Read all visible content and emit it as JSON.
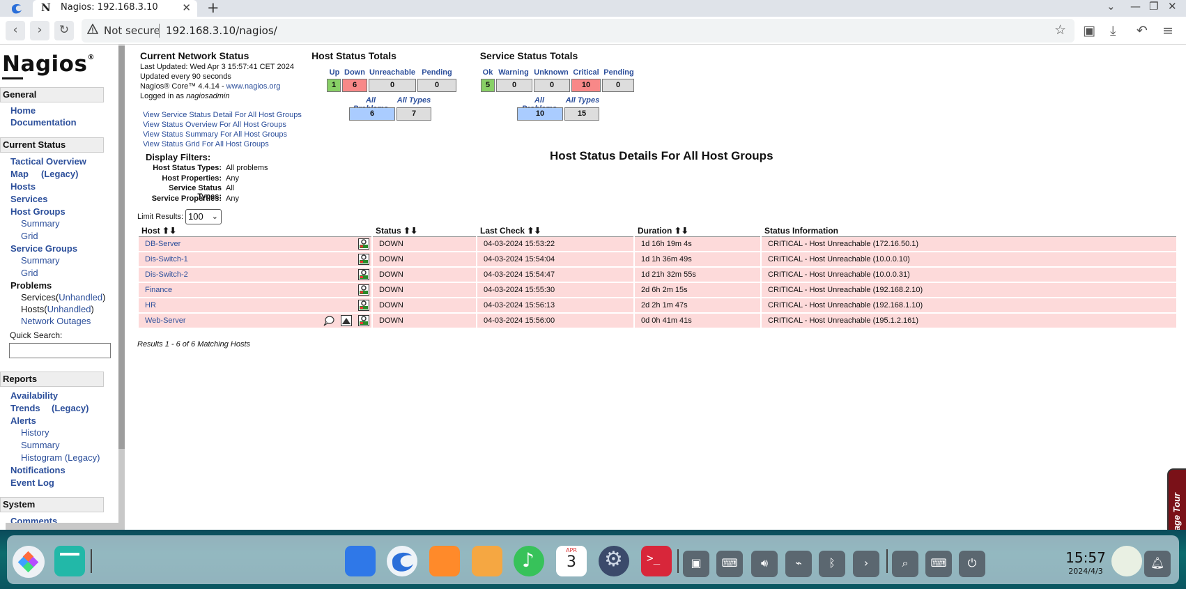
{
  "browser": {
    "tab_title": "Nagios: 192.168.3.10",
    "tab_favicon": "N",
    "security": "Not secure",
    "url": "192.168.3.10/nagios/"
  },
  "sidebar": {
    "logo": "Nagios",
    "logo_mark": "®",
    "sections": [
      {
        "title": "General",
        "items": [
          "Home",
          "Documentation"
        ]
      },
      {
        "title": "Current Status"
      },
      {
        "title": "Reports"
      },
      {
        "title": "System"
      }
    ],
    "current_status": {
      "tactical": "Tactical Overview",
      "map": "Map",
      "map_legacy": "(Legacy)",
      "hosts": "Hosts",
      "services": "Services",
      "host_groups": "Host Groups",
      "hg_summary": "Summary",
      "hg_grid": "Grid",
      "service_groups": "Service Groups",
      "sg_summary": "Summary",
      "sg_grid": "Grid",
      "problems": "Problems",
      "p_services": "Services",
      "p_services_un": "Unhandled",
      "p_hosts": "Hosts",
      "p_hosts_un": "Unhandled",
      "p_outages": "Network Outages"
    },
    "quick_search": "Quick Search:",
    "reports": {
      "availability": "Availability",
      "trends": "Trends",
      "trends_legacy": "(Legacy)",
      "alerts": "Alerts",
      "history": "History",
      "summary": "Summary",
      "histogram": "Histogram (Legacy)",
      "notifications": "Notifications",
      "event_log": "Event Log"
    },
    "system": {
      "comments": "Comments"
    }
  },
  "status_info": {
    "title": "Current Network Status",
    "last_updated": "Last Updated: Wed Apr 3 15:57:41 CET 2024",
    "interval": "Updated every 90 seconds",
    "core_prefix": "Nagios® Core™ 4.4.14 - ",
    "core_link": "www.nagios.org",
    "logged_prefix": "Logged in as ",
    "user": "nagiosadmin",
    "links": [
      "View Service Status Detail For All Host Groups",
      "View Status Overview For All Host Groups",
      "View Status Summary For All Host Groups",
      "View Status Grid For All Host Groups"
    ]
  },
  "host_totals": {
    "title": "Host Status Totals",
    "labels": [
      "Up",
      "Down",
      "Unreachable",
      "Pending"
    ],
    "values": [
      "1",
      "6",
      "0",
      "0"
    ],
    "sub_labels": [
      "All Problems",
      "All Types"
    ],
    "sub_values": [
      "6",
      "7"
    ]
  },
  "service_totals": {
    "title": "Service Status Totals",
    "labels": [
      "Ok",
      "Warning",
      "Unknown",
      "Critical",
      "Pending"
    ],
    "values": [
      "5",
      "0",
      "0",
      "10",
      "0"
    ],
    "sub_labels": [
      "All Problems",
      "All Types"
    ],
    "sub_values": [
      "10",
      "15"
    ]
  },
  "colors": {
    "ok_green": "#88d066",
    "crit_red": "#f88888",
    "problems_blue": "#aaccff",
    "neutral": "#dddddd",
    "row_bg": "#fddada",
    "link": "#2c4f9b"
  },
  "filters": {
    "title": "Display Filters:",
    "rows": [
      {
        "k": "Host Status Types:",
        "v": "All problems"
      },
      {
        "k": "Host Properties:",
        "v": "Any"
      },
      {
        "k": "Service Status Types:",
        "v": "All"
      },
      {
        "k": "Service Properties:",
        "v": "Any"
      }
    ]
  },
  "table_title": "Host Status Details For All Host Groups",
  "limit": {
    "label": "Limit Results:",
    "value": "100"
  },
  "table": {
    "columns": [
      "Host",
      "Status",
      "Last Check",
      "Duration",
      "Status Information"
    ],
    "rows": [
      {
        "host": "DB-Server",
        "status": "DOWN",
        "last_check": "04-03-2024 15:53:22",
        "duration": "1d 16h 19m 4s",
        "info": "CRITICAL - Host Unreachable (172.16.50.1)"
      },
      {
        "host": "Dis-Switch-1",
        "status": "DOWN",
        "last_check": "04-03-2024 15:54:04",
        "duration": "1d 1h 36m 49s",
        "info": "CRITICAL - Host Unreachable (10.0.0.10)"
      },
      {
        "host": "Dis-Switch-2",
        "status": "DOWN",
        "last_check": "04-03-2024 15:54:47",
        "duration": "1d 21h 32m 55s",
        "info": "CRITICAL - Host Unreachable (10.0.0.31)"
      },
      {
        "host": "Finance",
        "status": "DOWN",
        "last_check": "04-03-2024 15:55:30",
        "duration": "2d 6h 2m 15s",
        "info": "CRITICAL - Host Unreachable (192.168.2.10)"
      },
      {
        "host": "HR",
        "status": "DOWN",
        "last_check": "04-03-2024 15:56:13",
        "duration": "2d 2h 1m 47s",
        "info": "CRITICAL - Host Unreachable (192.168.1.10)"
      },
      {
        "host": "Web-Server",
        "status": "DOWN",
        "last_check": "04-03-2024 15:56:00",
        "duration": "0d 0h 41m 41s",
        "info": "CRITICAL - Host Unreachable (195.1.2.161)"
      }
    ]
  },
  "results": "Results 1 - 6 of 6 Matching Hosts",
  "page_tour": "Page Tour",
  "taskbar": {
    "time": "15:57",
    "date": "2024/4/3",
    "calendar_month": "APR",
    "calendar_day": "3"
  }
}
